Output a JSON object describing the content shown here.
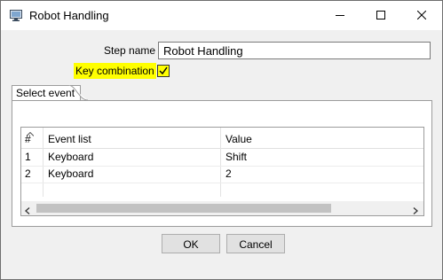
{
  "window": {
    "title": "Robot Handling",
    "icons": {
      "app": "computer-icon",
      "minimize": "minimize-icon",
      "maximize": "maximize-icon",
      "close": "close-icon"
    }
  },
  "form": {
    "step_name_label": "Step name",
    "step_name_value": "Robot Handling",
    "key_combination_label": "Key combination",
    "key_combination_checked": true,
    "highlight_color": "#ffff00"
  },
  "tabs": [
    {
      "label": "Select event",
      "active": true
    }
  ],
  "table": {
    "columns": [
      "#",
      "Event list",
      "Value"
    ],
    "rows": [
      [
        "1",
        "Keyboard",
        "Shift"
      ],
      [
        "2",
        "Keyboard",
        "2"
      ]
    ]
  },
  "buttons": {
    "ok": "OK",
    "cancel": "Cancel"
  }
}
